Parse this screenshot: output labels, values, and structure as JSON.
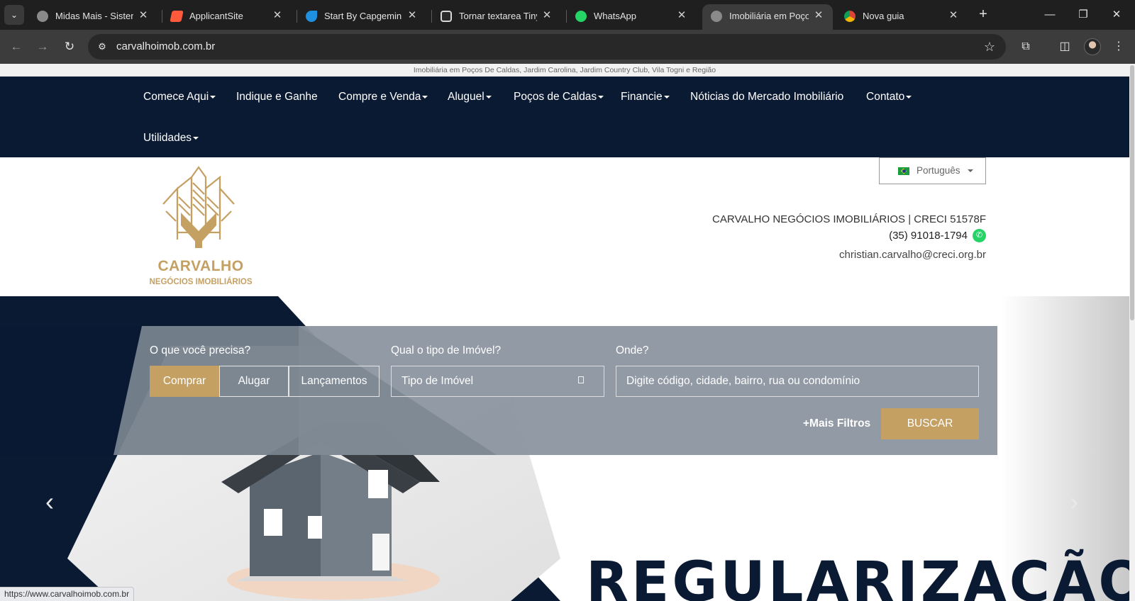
{
  "browser": {
    "tabs": [
      {
        "title": "Midas Mais - Sistema",
        "icon": "globe-icon",
        "active": false
      },
      {
        "title": "ApplicantSite",
        "icon": "applicantsite-icon",
        "active": false
      },
      {
        "title": "Start By Capgemini",
        "icon": "capgemini-icon",
        "active": false
      },
      {
        "title": "Tornar textarea Tiny",
        "icon": "chatgpt-icon",
        "active": false
      },
      {
        "title": "WhatsApp",
        "icon": "whatsapp-icon",
        "active": false
      },
      {
        "title": "Imobiliária em Poços",
        "icon": "globe-icon",
        "active": true
      },
      {
        "title": "Nova guia",
        "icon": "chrome-icon",
        "active": false
      }
    ],
    "url": "carvalhoimob.com.br",
    "status_url": "https://www.carvalhoimob.com.br"
  },
  "site": {
    "tagline": "Imobiliária em Poços De Caldas, Jardim Carolina, Jardim Country Club, Vila Togni e Região",
    "nav": [
      {
        "label": "Comece Aqui",
        "dropdown": true
      },
      {
        "label": "Indique e Ganhe",
        "dropdown": false
      },
      {
        "label": "Compre e Venda",
        "dropdown": true
      },
      {
        "label": "Aluguel",
        "dropdown": true
      },
      {
        "label": "Poços de Caldas",
        "dropdown": true
      },
      {
        "label": "Financie",
        "dropdown": true
      },
      {
        "label": "Nóticias do Mercado Imobiliário",
        "dropdown": false
      },
      {
        "label": "Contato",
        "dropdown": true
      },
      {
        "label": "Utilidades",
        "dropdown": true
      }
    ],
    "logo": {
      "title": "CARVALHO",
      "subtitle": "NEGÓCIOS IMOBILIÁRIOS"
    },
    "language": "Português",
    "contact": {
      "company": "CARVALHO NEGÓCIOS IMOBILIÁRIOS | CRECI 51578F",
      "phone": "(35) 91018-1794",
      "email": "christian.carvalho@creci.org.br"
    },
    "search": {
      "label_need": "O que você precisa?",
      "label_type": "Qual o tipo de Imóvel?",
      "label_where": "Onde?",
      "modes": [
        "Comprar",
        "Alugar",
        "Lançamentos"
      ],
      "selected_mode": "Comprar",
      "type_value": "Tipo de Imóvel",
      "where_placeholder": "Digite código, cidade, bairro, rua ou condomínio",
      "more_filters": "+Mais Filtros",
      "submit": "BUSCAR"
    },
    "hero": {
      "headline": "REGULARIZAÇÃO",
      "prev": "‹",
      "next": "›"
    },
    "colors": {
      "navy": "#0b1a33",
      "gold": "#c4a063"
    }
  }
}
